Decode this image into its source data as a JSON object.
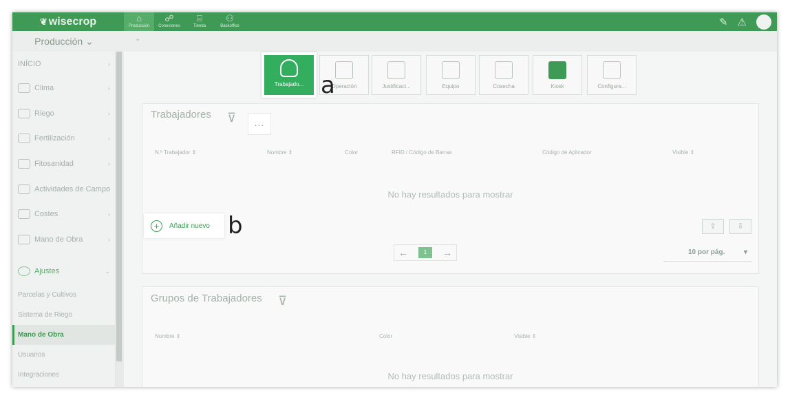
{
  "topbar": {
    "logo": "wisecrop",
    "nav": [
      "Producción",
      "Conexiones",
      "Tienda",
      "Backoffice"
    ]
  },
  "subbar": {
    "module": "Producción ⌄"
  },
  "sidebar": {
    "items": [
      {
        "label": "INÍCIO"
      },
      {
        "label": "Clima"
      },
      {
        "label": "Riego"
      },
      {
        "label": "Fertilización"
      },
      {
        "label": "Fitosanidad"
      },
      {
        "label": "Actividades de Campo"
      },
      {
        "label": "Costes"
      },
      {
        "label": "Mano de Obra"
      },
      {
        "label": "Ajustes"
      }
    ],
    "sub": [
      "Parcelas y Cultivos",
      "Sistema de Riego",
      "Mano de Obra",
      "Usuarios",
      "Integraciones"
    ]
  },
  "modules": [
    "Trabajado...",
    "Operación",
    "Justificaci...",
    "Equipo",
    "Cosecha",
    "Kiosk",
    "Configura..."
  ],
  "callouts": {
    "a": "a",
    "b": "b"
  },
  "trabajadores": {
    "title": "Trabajadores",
    "dots": "...",
    "columns": [
      "N.º Trabajador ⇕",
      "Nombre ⇕",
      "Color",
      "RFID / Código de Barras",
      "Código de Aplicador",
      "Visible ⇕"
    ],
    "empty": "No hay resultados para mostrar",
    "add": "Añadir nuevo",
    "page": "1",
    "per_page": "10 por pág."
  },
  "grupos": {
    "title": "Grupos de Trabajadores",
    "columns": [
      "Nombre ⇕",
      "Color",
      "Visible ⇕"
    ],
    "empty": "No hay resultados para mostrar"
  }
}
